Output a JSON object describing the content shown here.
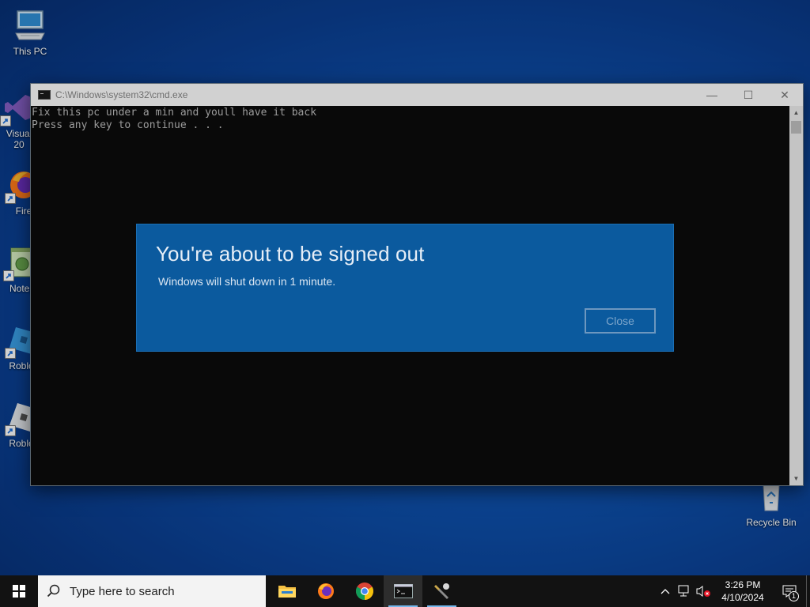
{
  "desktop": {
    "icons": [
      {
        "label": "This PC",
        "icon": "computer-icon"
      },
      {
        "label": "Visual",
        "label2": "20",
        "icon": "visual-studio-icon"
      },
      {
        "label": "Fire",
        "icon": "firefox-icon"
      },
      {
        "label": "Notep",
        "icon": "notepad-icon"
      },
      {
        "label": "Roblox",
        "icon": "roblox-studio-icon"
      },
      {
        "label": "Roblox",
        "icon": "roblox-player-icon"
      },
      {
        "label": "Recycle Bin",
        "icon": "recycle-bin-icon"
      }
    ]
  },
  "cmd": {
    "title": "C:\\Windows\\system32\\cmd.exe",
    "lines": [
      "Fix this pc under a min and youll have it back",
      "Press any key to continue . . ."
    ],
    "minimize_glyph": "—",
    "maximize_glyph": "☐",
    "close_glyph": "✕"
  },
  "dialog": {
    "title": "You're about to be signed out",
    "message": "Windows will shut down in 1 minute.",
    "close_label": "Close",
    "background": "#0b5a9e"
  },
  "taskbar": {
    "search_placeholder": "Type here to search",
    "apps": [
      {
        "name": "File Explorer",
        "icon": "folder-icon"
      },
      {
        "name": "Firefox",
        "icon": "firefox-icon"
      },
      {
        "name": "Chrome",
        "icon": "chrome-icon"
      },
      {
        "name": "Command Prompt",
        "icon": "cmd-icon"
      },
      {
        "name": "Tool",
        "icon": "tools-icon"
      }
    ],
    "tray": {
      "chevron": "^",
      "time": "3:26 PM",
      "date": "4/10/2024",
      "notification_count": "1"
    },
    "accent": "#76b9ed"
  }
}
